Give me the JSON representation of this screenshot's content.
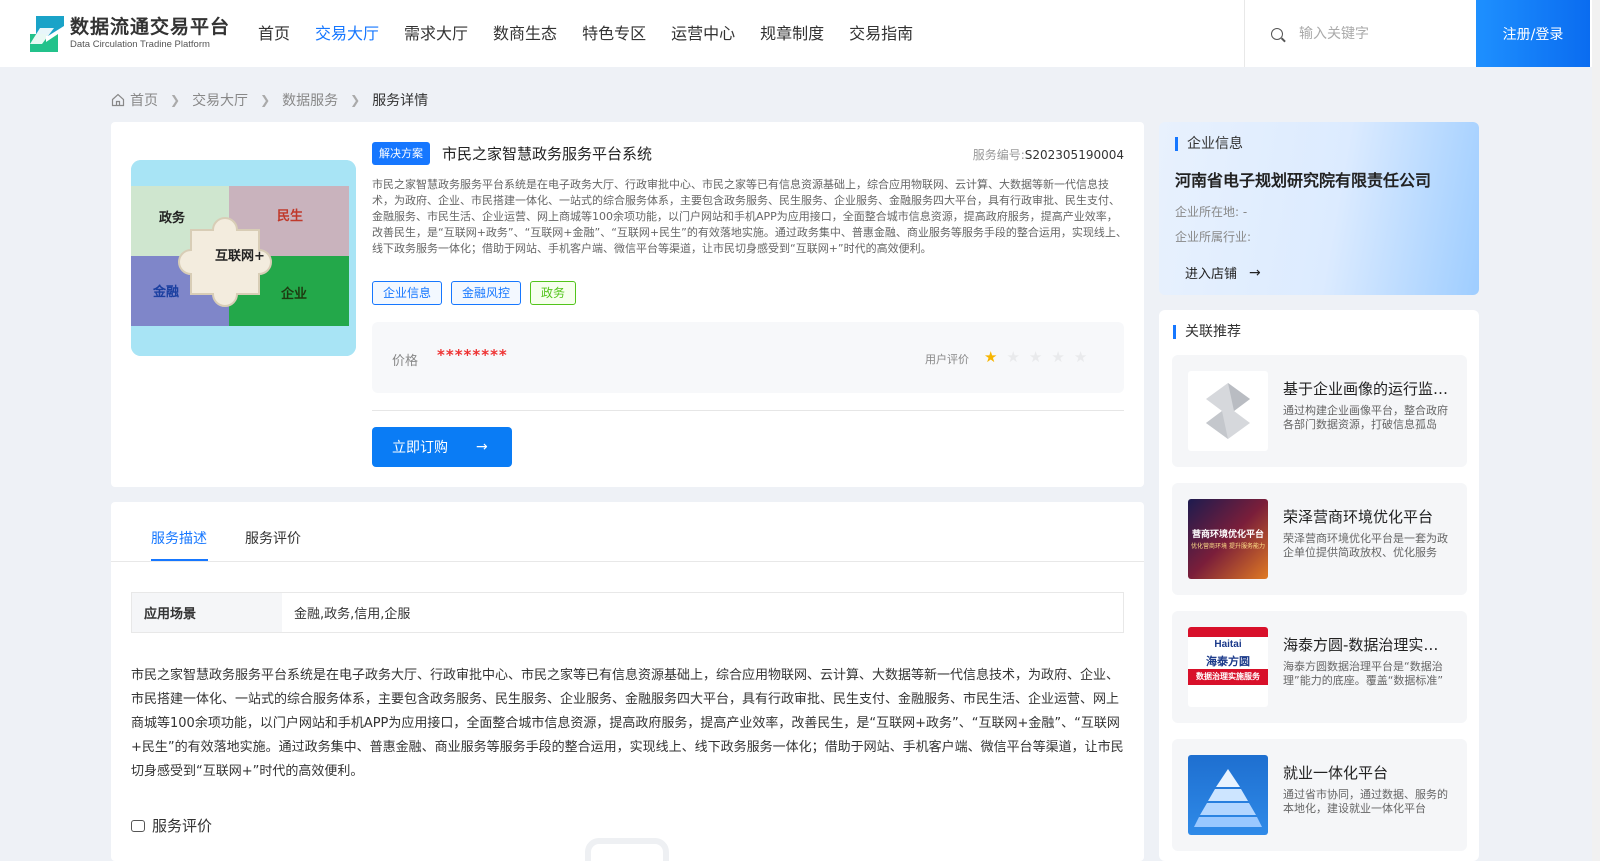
{
  "header": {
    "logo_cn": "数据流通交易平台",
    "logo_en": "Data Circulation Tradine Platform",
    "nav": [
      "首页",
      "交易大厅",
      "需求大厅",
      "数商生态",
      "特色专区",
      "运营中心",
      "规章制度",
      "交易指南"
    ],
    "nav_active_index": 1,
    "search_placeholder": "输入关键字",
    "login_label": "注册/登录"
  },
  "breadcrumb": {
    "items": [
      "首页",
      "交易大厅",
      "数据服务"
    ],
    "current": "服务详情"
  },
  "service": {
    "badge": "解决方案",
    "title": "市民之家智慧政务服务平台系统",
    "number_label": "服务编号:",
    "number_value": "S202305190004",
    "image_labels": [
      "政务",
      "民生",
      "互联网+",
      "金融",
      "企业"
    ],
    "short_description": "市民之家智慧政务服务平台系统是在电子政务大厅、行政审批中心、市民之家等已有信息资源基础上，综合应用物联网、云计算、大数据等新一代信息技术，为政府、企业、市民搭建一体化、一站式的综合服务体系，主要包含政务服务、民生服务、企业服务、金融服务四大平台，具有行政审批、民生支付、金融服务、市民生活、企业运营、网上商城等100余项功能，以门户网站和手机APP为应用接口，全面整合城市信息资源，提高政府服务，提高产业效率，改善民生，是“互联网+政务”、“互联网+金融”、“互联网+民生”的有效落地实施。通过政务集中、普惠金融、商业服务等服务手段的整合运用，实现线上、线下政务服务一体化；借助于网站、手机客户端、微信平台等渠道，让市民切身感受到“互联网+”时代的高效便利。",
    "tags": [
      "企业信息",
      "金融风控",
      "政务"
    ],
    "price_label": "价格",
    "price_value": "********",
    "rating_label": "用户评价",
    "rating": 1,
    "rating_max": 5,
    "order_label": "立即订购"
  },
  "detail": {
    "tabs": [
      "服务描述",
      "服务评价"
    ],
    "active_tab": 0,
    "scene_label": "应用场景",
    "scene_value": "金融,政务,信用,企服",
    "long_description": "市民之家智慧政务服务平台系统是在电子政务大厅、行政审批中心、市民之家等已有信息资源基础上，综合应用物联网、云计算、大数据等新一代信息技术，为政府、企业、市民搭建一体化、一站式的综合服务体系，主要包含政务服务、民生服务、企业服务、金融服务四大平台，具有行政审批、民生支付、金融服务、市民生活、企业运营、网上商城等100余项功能，以门户网站和手机APP为应用接口，全面整合城市信息资源，提高政府服务，提高产业效率，改善民生，是“互联网+政务”、“互联网+金融”、“互联网+民生”的有效落地实施。通过政务集中、普惠金融、商业服务等服务手段的整合运用，实现线上、线下政务服务一体化；借助于网站、手机客户端、微信平台等渠道，让市民切身感受到“互联网+”时代的高效便利。",
    "review_heading": "服务评价"
  },
  "company": {
    "section_title": "企业信息",
    "name": "河南省电子规划研究院有限责任公司",
    "location_label": "企业所在地:",
    "location_value": "-",
    "industry_label": "企业所属行业:",
    "industry_value": "",
    "enter_shop_label": "进入店铺"
  },
  "recommend": {
    "section_title": "关联推荐",
    "items": [
      {
        "title": "基于企业画像的运行监测平台",
        "desc": "通过构建企业画像平台，整合政府各部门数据资源，打破信息孤岛",
        "thumb": "logo"
      },
      {
        "title": "荣泽营商环境优化平台",
        "desc": "荣泽营商环境优化平台是一套为政企单位提供简政放权、优化服务",
        "thumb": "营商环境优化平台",
        "thumb_sub": "优化营商环境 提升服务能力"
      },
      {
        "title": "海泰方圆-数据治理实施服务",
        "desc": "海泰方圆数据治理平台是“数据治理”能力的底座。覆盖“数据标准”",
        "thumb": "海泰方圆",
        "thumb_brand": "Haitai",
        "thumb_sub": "数据治理实施服务"
      },
      {
        "title": "就业一体化平台",
        "desc": "通过省市协同，通过数据、服务的本地化，建设就业一体化平台",
        "thumb": "pyramid"
      }
    ]
  },
  "colors": {
    "primary": "#1677ff",
    "price": "#e33333",
    "star": "#f7b500",
    "tag_green": "#52c41a"
  }
}
